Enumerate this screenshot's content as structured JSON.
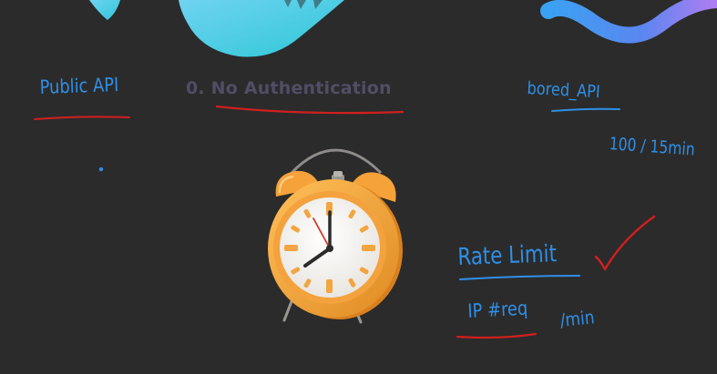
{
  "slide": {
    "heading": "0. No Authentication"
  },
  "annotations": {
    "public_api": "Public API",
    "bored_api": "bored_API",
    "rate": "100 / 15min",
    "rate_limit": "Rate Limit",
    "ip_req": "IP #req",
    "per_min": "/min"
  },
  "icons": {
    "clock": "alarm-clock-icon",
    "check": "checkmark-icon"
  },
  "colors": {
    "background": "#2b2b2b",
    "ink_blue": "#2f8fe6",
    "ink_red": "#d11f1f",
    "heading": "#514d66",
    "clock_body": "#f2a03a"
  }
}
